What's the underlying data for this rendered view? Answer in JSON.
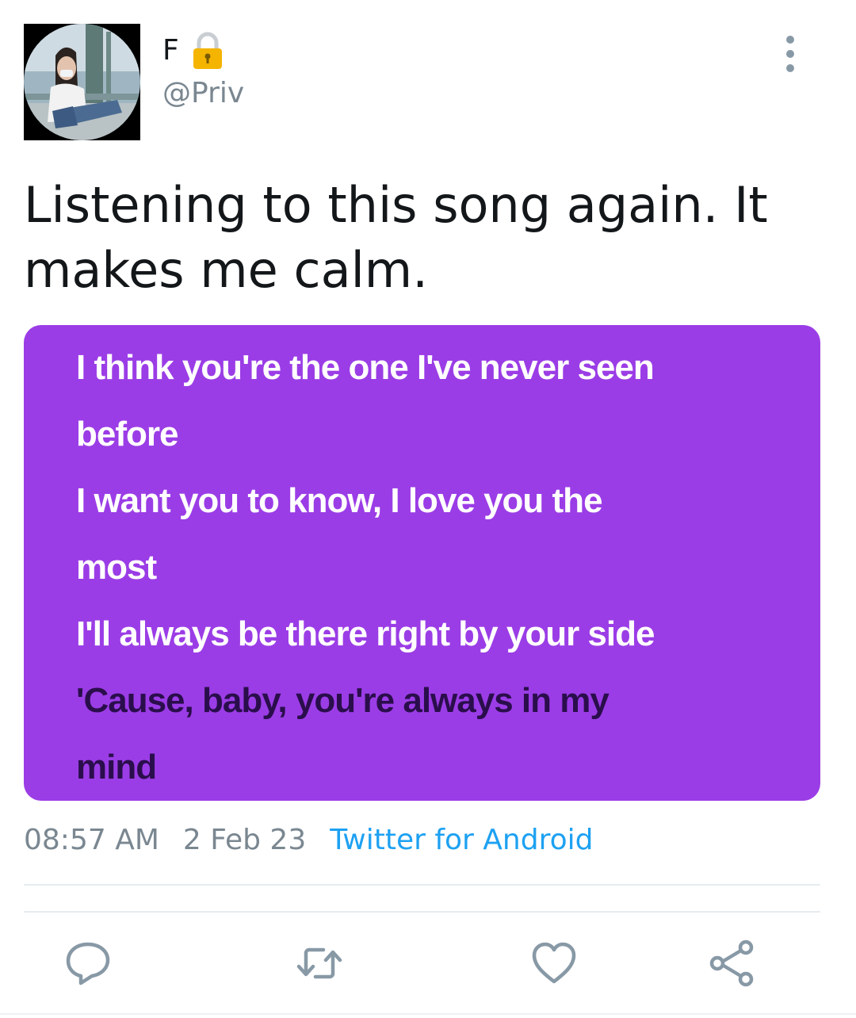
{
  "user": {
    "display_name": "F",
    "handle": "@Priv",
    "avatar_icon": "profile-photo",
    "protected_icon": "lock-icon"
  },
  "tweet": {
    "text": "Listening to this song again. It makes me calm."
  },
  "media": {
    "background_color": "#9b3de6",
    "lyrics": [
      {
        "text": "I think you're the one I've never seen",
        "state": "past"
      },
      {
        "text": "before",
        "state": "past"
      },
      {
        "text": "I want you to know, I love you the",
        "state": "past"
      },
      {
        "text": "most",
        "state": "past"
      },
      {
        "text": "I'll always be there right by your side",
        "state": "past"
      },
      {
        "text": "'Cause, baby, you're always in my",
        "state": "current"
      },
      {
        "text": "mind",
        "state": "current"
      }
    ]
  },
  "meta": {
    "time": "08:57 AM",
    "date": "2 Feb 23",
    "source": "Twitter for Android"
  },
  "actions": {
    "reply_icon": "reply-icon",
    "retweet_icon": "retweet-icon",
    "like_icon": "heart-icon",
    "share_icon": "share-icon",
    "more_icon": "more-vertical-icon"
  },
  "colors": {
    "link": "#1da1f2",
    "muted": "#7a8791",
    "icon": "#8899a6",
    "lock": "#f4b400"
  }
}
